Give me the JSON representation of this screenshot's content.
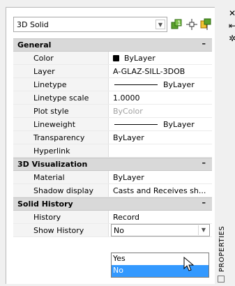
{
  "object_selector": {
    "value": "3D Solid"
  },
  "categories": [
    {
      "title": "General",
      "collapse_symbol": "–",
      "rows": [
        {
          "name": "Color",
          "value": "ByLayer"
        },
        {
          "name": "Layer",
          "value": "A-GLAZ-SILL-3DOB"
        },
        {
          "name": "Linetype",
          "value": "ByLayer"
        },
        {
          "name": "Linetype scale",
          "value": "1.0000"
        },
        {
          "name": "Plot style",
          "value": "ByColor"
        },
        {
          "name": "Lineweight",
          "value": "ByLayer"
        },
        {
          "name": "Transparency",
          "value": "ByLayer"
        },
        {
          "name": "Hyperlink",
          "value": ""
        }
      ]
    },
    {
      "title": "3D Visualization",
      "collapse_symbol": "–",
      "rows": [
        {
          "name": "Material",
          "value": "ByLayer"
        },
        {
          "name": "Shadow display",
          "value": "Casts and Receives sh..."
        }
      ]
    },
    {
      "title": "Solid History",
      "collapse_symbol": "–",
      "rows": [
        {
          "name": "History",
          "value": "Record"
        },
        {
          "name": "Show History",
          "value": "No"
        }
      ]
    }
  ],
  "dropdown": {
    "options": [
      "Yes",
      "No"
    ],
    "selected_index": 1
  },
  "side_panel": {
    "title": "PROPERTIES",
    "icons": [
      "close-icon",
      "autohide-icon",
      "settings-icon"
    ]
  },
  "colors": {
    "selection": "#3399ff",
    "category_bg": "#d9d9d9"
  }
}
